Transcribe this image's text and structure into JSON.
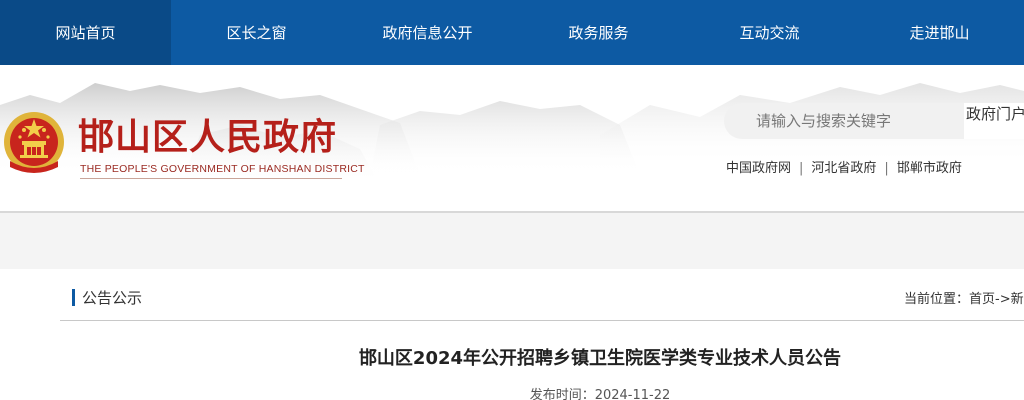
{
  "nav": {
    "items": [
      {
        "label": "网站首页"
      },
      {
        "label": "区长之窗"
      },
      {
        "label": "政府信息公开"
      },
      {
        "label": "政务服务"
      },
      {
        "label": "互动交流"
      },
      {
        "label": "走进邯山"
      }
    ],
    "active_index": 0
  },
  "header": {
    "title": "邯山区人民政府",
    "subtitle": "THE PEOPLE'S GOVERNMENT OF HANSHAN DISTRICT",
    "emblem_icon": "national-emblem-icon"
  },
  "search": {
    "placeholder": "请输入与搜索关键字",
    "scope": "政府门户"
  },
  "links": {
    "items": [
      "中国政府网",
      "河北省政府",
      "邯郸市政府"
    ],
    "separator": "|"
  },
  "section": {
    "title": "公告公示",
    "location_label": "当前位置：",
    "breadcrumb": "首页->新"
  },
  "article": {
    "title": "邯山区2024年公开招聘乡镇卫生院医学类专业技术人员公告",
    "date_label": "发布时间：",
    "date": "2024-11-22"
  },
  "colors": {
    "nav_bg": "#0d5aa3",
    "nav_active": "#0a4a87",
    "title_red": "#b5201a"
  }
}
